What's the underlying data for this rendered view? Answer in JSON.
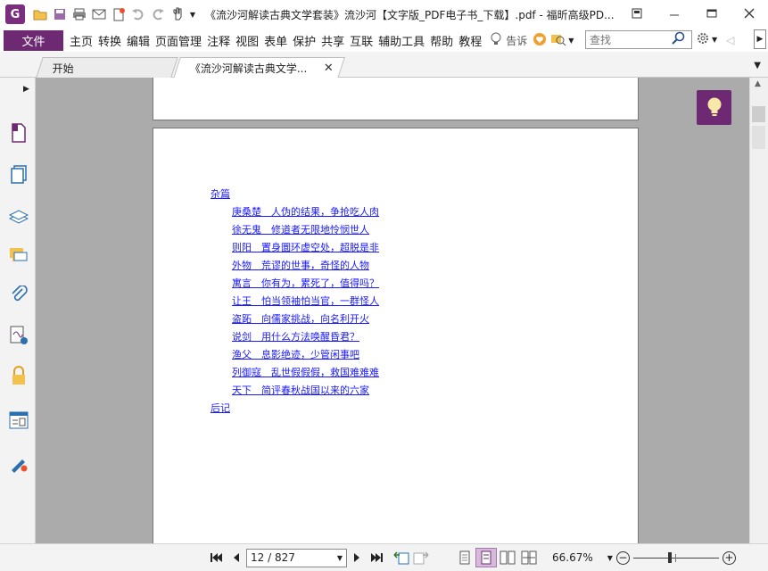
{
  "window": {
    "title": "《流沙河解读古典文学套装》流沙河【文字版_PDF电子书_下载】.pdf - 福昕高级PD...",
    "app_logo_letter": "G"
  },
  "menu": {
    "file": "文件",
    "items": [
      "主页",
      "转换",
      "编辑",
      "页面管理",
      "注释",
      "视图",
      "表单",
      "保护",
      "共享",
      "互联",
      "辅助工具",
      "帮助",
      "教程"
    ],
    "tell_me": "告诉",
    "search_placeholder": "查找"
  },
  "tabs": [
    {
      "label": "开始",
      "active": false
    },
    {
      "label": "《流沙河解读古典文学...",
      "active": true
    }
  ],
  "toc": {
    "entries": [
      {
        "text": "杂篇",
        "level": 0
      },
      {
        "text": "庚桑楚　人伪的结果，争抢吃人肉",
        "level": 1
      },
      {
        "text": "徐无鬼　修道者无限地怜悯世人",
        "level": 1
      },
      {
        "text": "则阳　置身圜环虚空处，超脱是非",
        "level": 1
      },
      {
        "text": "外物　荒谬的世事，奇怪的人物",
        "level": 1
      },
      {
        "text": "寓言　你有为，累死了，值得吗？",
        "level": 1
      },
      {
        "text": "让王　怕当领袖怕当官，一群怪人",
        "level": 1
      },
      {
        "text": "盗跖　向儒家挑战，向名利开火",
        "level": 1
      },
      {
        "text": "说剑　用什么方法唤醒昏君？",
        "level": 1
      },
      {
        "text": "渔父　息影绝迹，少管闲事吧",
        "level": 1
      },
      {
        "text": "列御寇　乱世假假假，救国难难难",
        "level": 1
      },
      {
        "text": "天下　简评春秋战国以来的六家",
        "level": 1
      },
      {
        "text": "后记",
        "level": 0
      }
    ]
  },
  "status": {
    "page_display": "12 / 827",
    "current_page": 12,
    "total_pages": 827,
    "zoom": "66.67%",
    "zoom_level": 0.42
  },
  "colors": {
    "brand": "#6d2a73",
    "link": "#1a1aff",
    "doc_background": "#ababab"
  }
}
